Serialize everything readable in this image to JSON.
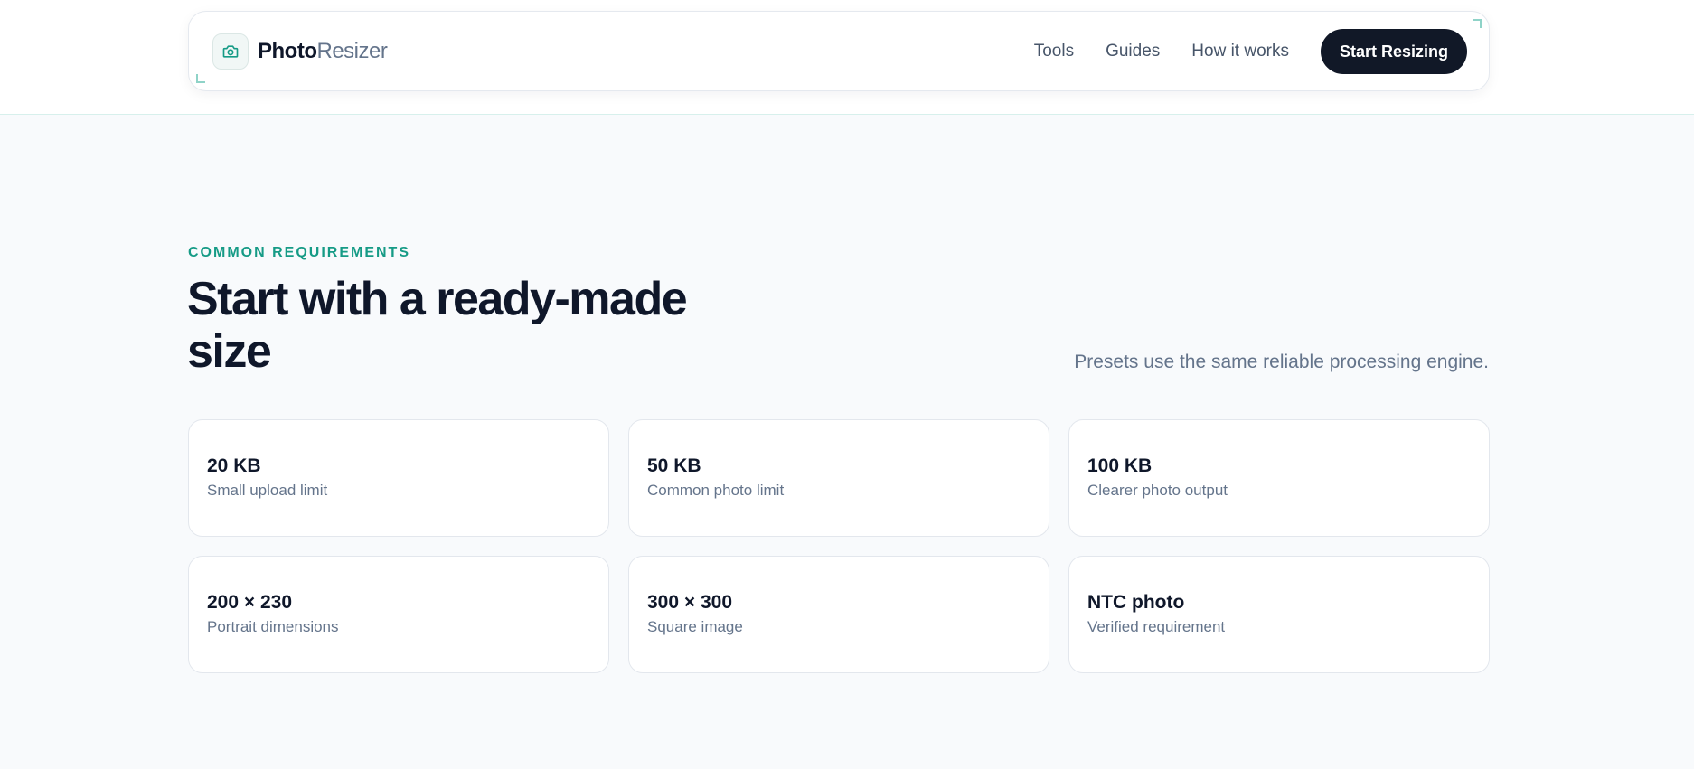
{
  "header": {
    "brand_strong": "Photo",
    "brand_light": "Resizer",
    "brand_icon": "camera-icon",
    "nav_links": [
      "Tools",
      "Guides",
      "How it works"
    ],
    "cta_label": "Start Resizing"
  },
  "section": {
    "eyebrow": "COMMON REQUIREMENTS",
    "heading": "Start with a ready-made size",
    "subtext": "Presets use the same reliable processing engine."
  },
  "presets": [
    {
      "title": "20 KB",
      "subtitle": "Small upload limit"
    },
    {
      "title": "50 KB",
      "subtitle": "Common photo limit"
    },
    {
      "title": "100 KB",
      "subtitle": "Clearer photo output"
    },
    {
      "title": "200 × 230",
      "subtitle": "Portrait dimensions"
    },
    {
      "title": "300 × 300",
      "subtitle": "Square image"
    },
    {
      "title": "NTC photo",
      "subtitle": "Verified requirement"
    }
  ],
  "colors": {
    "accent": "#169b86",
    "cta_background": "#111827",
    "page_background": "#f8fafc"
  }
}
